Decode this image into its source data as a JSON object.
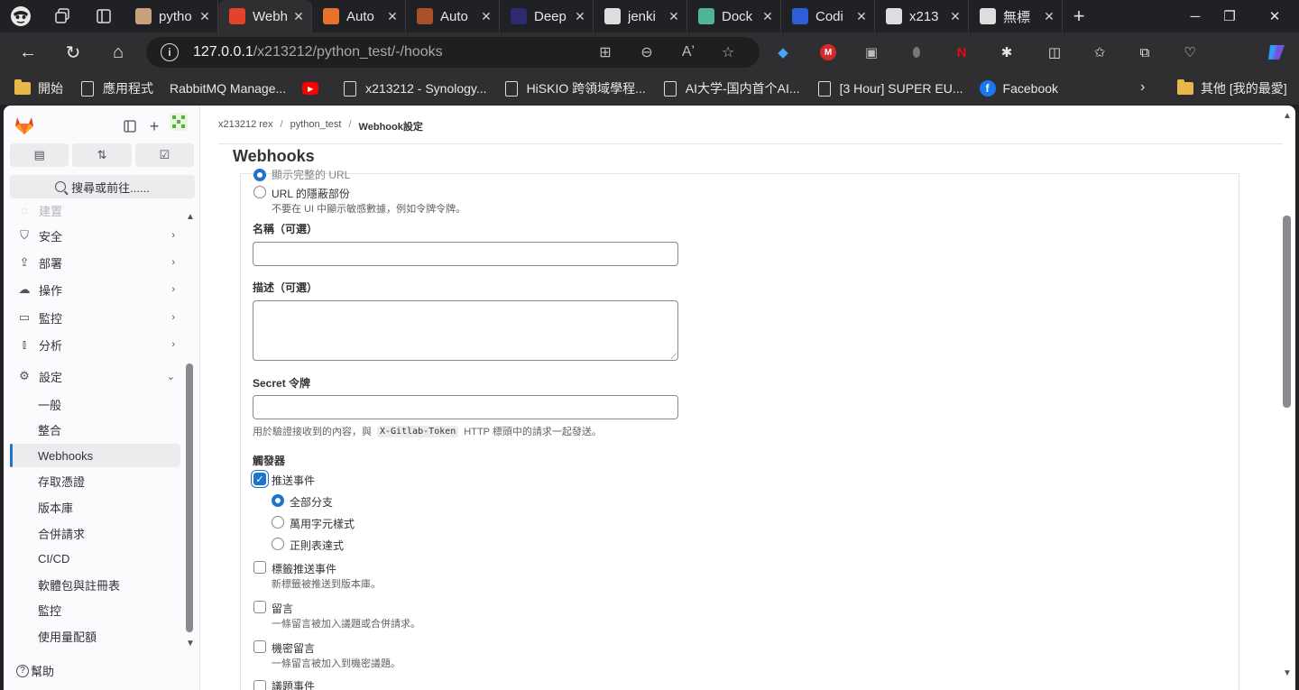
{
  "browser": {
    "tabs": [
      {
        "label": "pytho",
        "fav_color": "#c7a27c"
      },
      {
        "label": "Webh",
        "fav_color": "#e24329",
        "active": true
      },
      {
        "label": "Auto",
        "fav_color": "#e8712b"
      },
      {
        "label": "Auto",
        "fav_color": "#a8502a"
      },
      {
        "label": "Deep",
        "fav_color": "#2b2b6e"
      },
      {
        "label": "jenki",
        "fav_color": "#dddddd"
      },
      {
        "label": "Dock",
        "fav_color": "#4fb595"
      },
      {
        "label": "Codi",
        "fav_color": "#2e5dd9"
      },
      {
        "label": "x213",
        "fav_color": "#dddddd"
      },
      {
        "label": "無標",
        "fav_color": "#dddddd"
      }
    ],
    "address": {
      "host": "127.0.0.1",
      "path": "/x213212/python_test/-/hooks"
    },
    "bookmarks": [
      {
        "label": "開始",
        "icon": "folder-icon"
      },
      {
        "label": "應用程式",
        "icon": "page-icon"
      },
      {
        "label": "RabbitMQ Manage...",
        "icon": ""
      },
      {
        "label": "",
        "icon": "youtube-icon"
      },
      {
        "label": "x213212 - Synology...",
        "icon": "page-icon"
      },
      {
        "label": "HiSKIO 跨領域學程...",
        "icon": "page-icon"
      },
      {
        "label": "AI大学-国内首个AI...",
        "icon": "page-icon"
      },
      {
        "label": "[3 Hour] SUPER EU...",
        "icon": "page-icon"
      },
      {
        "label": "Facebook",
        "icon": "facebook-icon"
      }
    ],
    "other_bookmarks": "其他 [我的最愛]"
  },
  "sidebar": {
    "search": "搜尋或前往......",
    "partial_top": "建置",
    "items": [
      {
        "label": "安全",
        "icon": "shield-icon"
      },
      {
        "label": "部署",
        "icon": "deploy-icon"
      },
      {
        "label": "操作",
        "icon": "cloud-icon"
      },
      {
        "label": "監控",
        "icon": "monitor-icon"
      },
      {
        "label": "分析",
        "icon": "chart-icon"
      },
      {
        "label": "設定",
        "icon": "gear-icon"
      }
    ],
    "sub_items": [
      "一般",
      "整合",
      "Webhooks",
      "存取憑證",
      "版本庫",
      "合併請求",
      "CI/CD",
      "軟體包與註冊表",
      "監控",
      "使用量配額"
    ],
    "help": "幫助"
  },
  "main": {
    "breadcrumb": [
      "x213212 rex",
      "python_test",
      "Webhook設定"
    ],
    "title": "Webhooks",
    "mask": {
      "show_full_partial": "顯示完整的 URL",
      "mask_option": "URL 的隱蔽部份",
      "mask_help": "不要在 UI 中顯示敏感數據，例如令牌令牌。"
    },
    "name_label": "名稱（可選）",
    "desc_label": "描述（可選）",
    "secret_label": "Secret 令牌",
    "secret_help_prefix": "用於驗證接收到的內容，與",
    "secret_help_code": "X-Gitlab-Token",
    "secret_help_suffix": "HTTP 標頭中的請求一起發送。",
    "triggers_label": "觸發器",
    "push_events": "推送事件",
    "push_options": [
      "全部分支",
      "萬用字元樣式",
      "正則表達式"
    ],
    "tag_events": "標籤推送事件",
    "tag_help": "新標籤被推送到版本庫。",
    "comments": "留言",
    "comments_help": "一條留言被加入議題或合併請求。",
    "confidential_comments": "機密留言",
    "confidential_help": "一條留言被加入到機密議題。",
    "issue_events_partial": "議題事件"
  }
}
